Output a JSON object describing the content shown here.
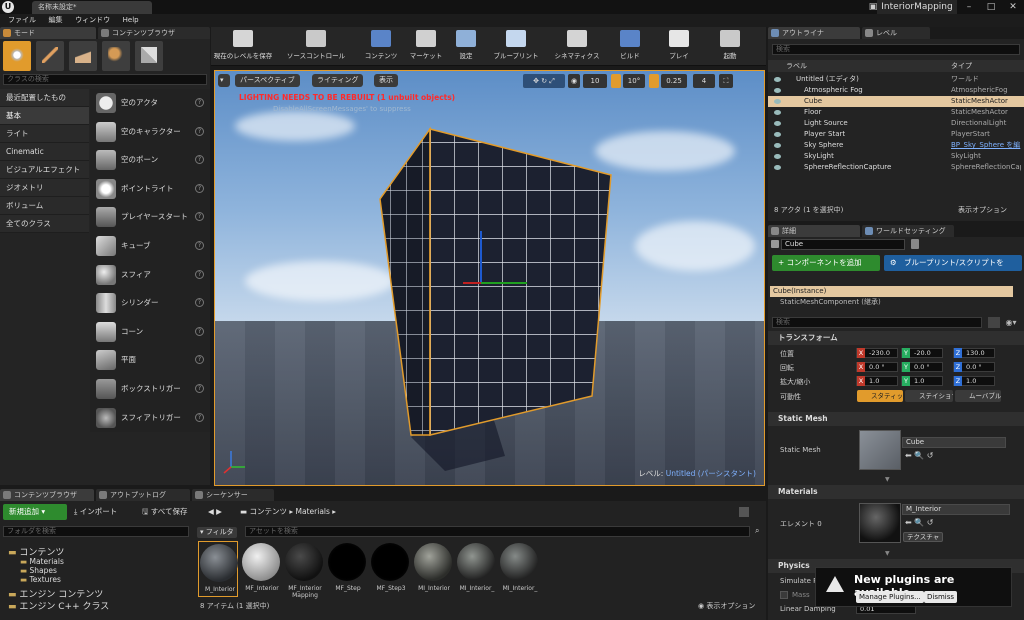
{
  "titlebar": {
    "doc_tab": "名称未設定*",
    "project": "InteriorMapping"
  },
  "menu": [
    "ファイル",
    "編集",
    "ウィンドウ",
    "Help"
  ],
  "modes_panel": {
    "tabs": [
      "モード",
      "コンテンツブラウザ"
    ],
    "search_placeholder": "クラスの検索",
    "categories": [
      "最近配置したもの",
      "基本",
      "ライト",
      "Cinematic",
      "ビジュアルエフェクト",
      "ジオメトリ",
      "ボリューム",
      "全てのクラス"
    ],
    "selected_category": "基本",
    "assets": [
      "空のアクタ",
      "空のキャラクター",
      "空のポーン",
      "ポイントライト",
      "プレイヤースタート",
      "キューブ",
      "スフィア",
      "シリンダー",
      "コーン",
      "平面",
      "ボックストリガー",
      "スフィアトリガー"
    ]
  },
  "toolbar": {
    "buttons": [
      "現在のレベルを保存",
      "ソースコントロール",
      "コンテンツ",
      "マーケット",
      "設定",
      "ブループリント",
      "シネマティクス",
      "ビルド",
      "プレイ",
      "起動"
    ]
  },
  "viewport": {
    "perspective": "パースペクティブ",
    "lighting": "ライティング",
    "show": "表示",
    "warning": "LIGHTING NEEDS TO BE REBUILT (1 unbuilt objects)",
    "warning_sub": "DisableAllScreenMessages' to suppress",
    "grid_snap": "10",
    "rot_snap": "10°",
    "scale_snap": "0.25",
    "cam_speed": "4",
    "level_prefix": "レベル:",
    "level_name": "Untitled (パーシスタント)"
  },
  "outliner": {
    "tabs": [
      "アウトライナ",
      "レベル"
    ],
    "search_placeholder": "検索",
    "col_label": "ラベル",
    "col_type": "タイプ",
    "rows": [
      {
        "name": "Untitled (エディタ)",
        "type": "ワールド"
      },
      {
        "name": "Atmospheric Fog",
        "type": "AtmosphericFog"
      },
      {
        "name": "Cube",
        "type": "StaticMeshActor"
      },
      {
        "name": "Floor",
        "type": "StaticMeshActor"
      },
      {
        "name": "Light Source",
        "type": "DirectionalLight"
      },
      {
        "name": "Player Start",
        "type": "PlayerStart"
      },
      {
        "name": "Sky Sphere",
        "type": "BP_Sky_Sphere を編"
      },
      {
        "name": "SkyLight",
        "type": "SkyLight"
      },
      {
        "name": "SphereReflectionCapture",
        "type": "SphereReflectionCapture"
      }
    ],
    "selected_index": 2,
    "footer": "8 アクタ (1 を選択中)",
    "view_options": "表示オプション"
  },
  "details": {
    "tabs": [
      "詳細",
      "ワールドセッティング"
    ],
    "name": "Cube",
    "add_component": "+ コンポーネントを追加",
    "blueprint_btn": "ブループリント/スクリプトを",
    "instance": "Cube(Instance)",
    "component": "StaticMeshComponent (継承)",
    "search_placeholder": "検索",
    "transform_title": "トランスフォーム",
    "location_label": "位置",
    "rotation_label": "回転",
    "scale_label": "拡大/縮小",
    "mobility_label": "可動性",
    "location": [
      "-230.0",
      "-20.0",
      "130.0"
    ],
    "rotation": [
      "0.0 °",
      "0.0 °",
      "0.0 °"
    ],
    "scale": [
      "1.0",
      "1.0",
      "1.0"
    ],
    "mobility": [
      "スタティック",
      "ステイショナリ",
      "ムーバブル"
    ],
    "static_mesh_title": "Static Mesh",
    "static_mesh_label": "Static Mesh",
    "static_mesh_value": "Cube",
    "materials_title": "Materials",
    "element_label": "エレメント 0",
    "material_value": "M_Interior",
    "texture_btn": "テクスチャ",
    "physics_title": "Physics",
    "simulate_label": "Simulate Ph",
    "mass_label": "Mass",
    "linear_damping_label": "Linear Damping",
    "linear_damping_value": "0.01"
  },
  "notification": {
    "title": "New plugins are available",
    "manage": "Manage Plugins...",
    "dismiss": "Dismiss"
  },
  "content_browser": {
    "tabs": [
      "コンテンツブラウザ",
      "アウトプットログ",
      "シーケンサー"
    ],
    "add_new": "新規追加",
    "import": "インポート",
    "save_all": "すべて保存",
    "path": [
      "コンテンツ",
      "Materials"
    ],
    "folder_search_placeholder": "フォルダを検索",
    "tree": [
      "コンテンツ",
      "Materials",
      "Shapes",
      "Textures",
      "エンジン コンテンツ",
      "エンジン C++ クラス"
    ],
    "filter": "フィルタ",
    "asset_search_placeholder": "アセットを検索",
    "assets": [
      "M_Interior",
      "MF_Interior",
      "MF_Interior Mapping",
      "MF_Step",
      "MF_Step3",
      "MI_Interior",
      "MI_Interior_",
      "MI_Interior_"
    ],
    "footer": "8 アイテム (1 選択中)",
    "view_options": "表示オプション"
  },
  "colors": {
    "accent": "#e19b2c",
    "green": "#2e8b2e",
    "blue": "#1f5f9e",
    "warning": "#ff2a2a"
  }
}
